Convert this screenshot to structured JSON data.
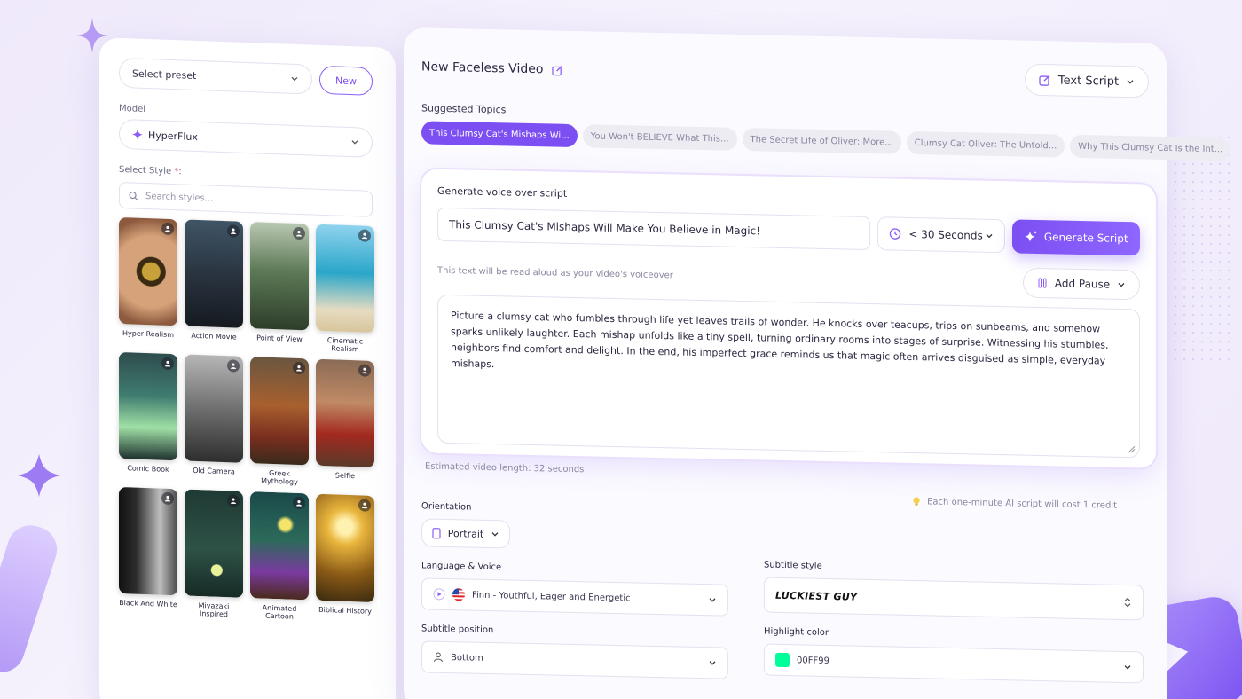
{
  "colors": {
    "accent": "#7c4ff2",
    "highlight": "#00FF99"
  },
  "sidebar": {
    "preset_placeholder": "Select preset",
    "new_label": "New",
    "model_label": "Model",
    "model_value": "HyperFlux",
    "style_label": "Select Style",
    "style_required": "*",
    "style_colon": ":",
    "search_placeholder": "Search styles...",
    "styles": [
      {
        "name": "Hyper Realism"
      },
      {
        "name": "Action Movie"
      },
      {
        "name": "Point of View"
      },
      {
        "name": "Cinematic Realism"
      },
      {
        "name": "Comic Book"
      },
      {
        "name": "Old Camera"
      },
      {
        "name": "Greek Mythology"
      },
      {
        "name": "Selfie"
      },
      {
        "name": "Black And White"
      },
      {
        "name": "Miyazaki Inspired"
      },
      {
        "name": "Animated Cartoon"
      },
      {
        "name": "Biblical History"
      }
    ]
  },
  "main": {
    "title": "New Faceless Video",
    "script_mode": "Text Script",
    "topics_label": "Suggested Topics",
    "topics": [
      "This Clumsy Cat's Mishaps Wi...",
      "You Won't BELIEVE What This...",
      "The Secret Life of Oliver: More...",
      "Clumsy Cat Oliver: The Untold...",
      "Why This Clumsy Cat Is the Int..."
    ],
    "voice": {
      "heading": "Generate voice over script",
      "title_value": "This Clumsy Cat's Mishaps Will Make You Believe in Magic!",
      "duration": "< 30 Seconds",
      "generate_label": "Generate Script",
      "hint": "This text will be read aloud as your video's voiceover",
      "pause_label": "Add Pause",
      "script_text": "Picture a clumsy cat who fumbles through life yet leaves trails of wonder. He knocks over teacups, trips on sunbeams, and somehow sparks unlikely laughter. Each mishap unfolds like a tiny spell, turning ordinary rooms into stages of surprise. Witnessing his stumbles, neighbors find comfort and delight. In the end, his imperfect grace reminds us that magic often arrives disguised as simple, everyday mishaps."
    },
    "estimated": "Estimated video length: 32 seconds",
    "credit_note": "Each one-minute AI script will cost 1 credit",
    "orientation_label": "Orientation",
    "orientation_value": "Portrait",
    "language_label": "Language & Voice",
    "language_value": "Finn - Youthful, Eager and Energetic",
    "subtitle_style_label": "Subtitle style",
    "subtitle_style_value": "LUCKIEST GUY",
    "subtitle_position_label": "Subtitle position",
    "subtitle_position_value": "Bottom",
    "highlight_label": "Highlight color",
    "highlight_value": "00FF99"
  }
}
